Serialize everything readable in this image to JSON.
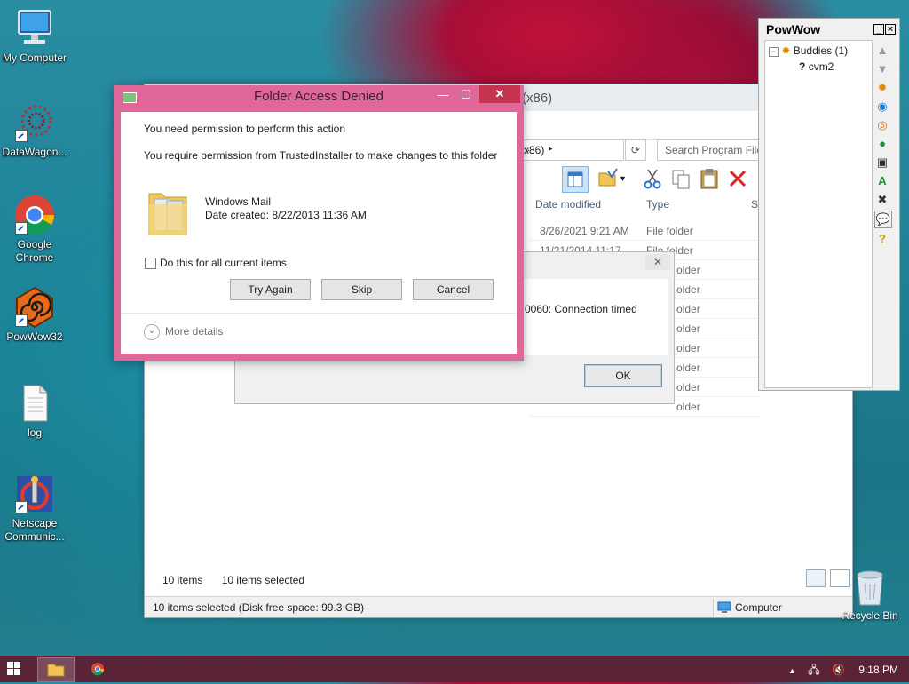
{
  "desktop": {
    "icons": [
      {
        "label": "My Computer"
      },
      {
        "label": "DataWagon..."
      },
      {
        "label": "Google Chrome"
      },
      {
        "label": "PowWow32"
      },
      {
        "label": "log"
      },
      {
        "label": "Netscape Communic..."
      }
    ],
    "recycle_bin": "Recycle Bin"
  },
  "explorer": {
    "title_fragment": "(x86)",
    "address_fragment": "x86)",
    "search_placeholder": "Search Program File",
    "columns": {
      "date": "Date modified",
      "type": "Type",
      "size": "S"
    },
    "rows": [
      {
        "date": "8/26/2021 9:21 AM",
        "type": "File folder"
      },
      {
        "date": "11/21/2014 11:17 ...",
        "type": "File folder"
      },
      {
        "date": "",
        "type": "older"
      },
      {
        "date": "",
        "type": "older"
      },
      {
        "date": "",
        "type": "older"
      },
      {
        "date": "",
        "type": "older"
      },
      {
        "date": "",
        "type": "older"
      },
      {
        "date": "",
        "type": "older"
      },
      {
        "date": "",
        "type": "older"
      },
      {
        "date": "",
        "type": "older"
      }
    ],
    "item_count": "10 items",
    "selected_count": "10 items selected",
    "status_left": "10 items selected (Disk free space: 99.3 GB)",
    "status_right": "Computer"
  },
  "error_dialog": {
    "message_fragment": "0060: Connection timed",
    "ok_label": "OK"
  },
  "access_denied": {
    "title": "Folder Access Denied",
    "line1": "You need permission to perform this action",
    "line2": "You require permission from TrustedInstaller to make changes to this folder",
    "folder_name": "Windows Mail",
    "date_created": "Date created: 8/22/2013 11:36 AM",
    "checkbox_label": "Do this for all current items",
    "buttons": {
      "try_again": "Try Again",
      "skip": "Skip",
      "cancel": "Cancel"
    },
    "more_details": "More details"
  },
  "powwow": {
    "title": "PowWow",
    "group": "Buddies (1)",
    "buddy": "cvm2"
  },
  "taskbar": {
    "clock": "9:18 PM"
  }
}
